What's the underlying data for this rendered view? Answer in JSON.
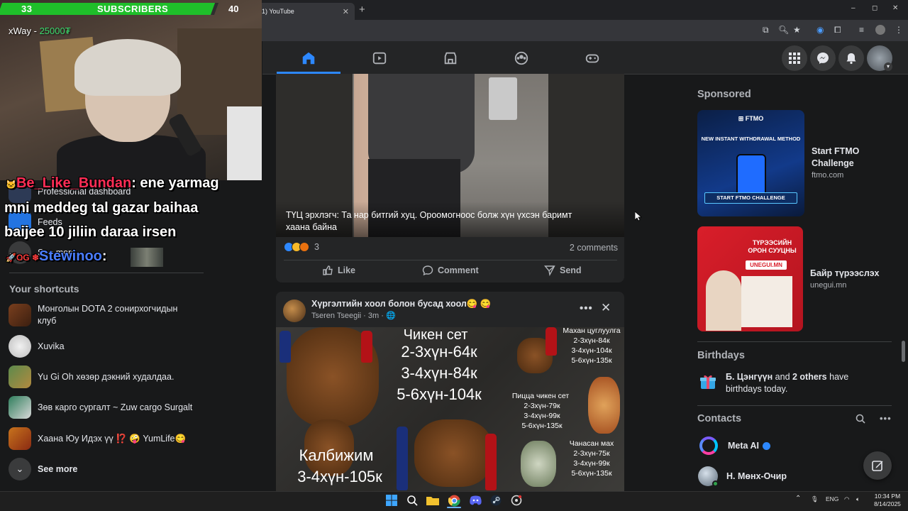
{
  "overlay": {
    "sub_left": "33",
    "sub_label": "SUBSCRIBERS",
    "sub_goal": "40",
    "streamer_name": "xWay - ",
    "streamer_count": "25000₮"
  },
  "browser": {
    "tab_title": "(1) YouTube",
    "new_tab": "+",
    "window_controls": [
      "–",
      "◻",
      "✕"
    ]
  },
  "sidebar": {
    "items": [
      {
        "label": "Professional dashboard"
      },
      {
        "label": "Feeds"
      },
      {
        "label": "See more"
      }
    ],
    "shortcuts_heading": "Your shortcuts",
    "shortcuts": [
      {
        "label": "Монголын DOTA 2 сонирхогчидын клуб"
      },
      {
        "label": "Xuvika"
      },
      {
        "label": "Yu Gi Oh хөзөр дэкний худалдаа."
      },
      {
        "label": "Зөв карго сургалт ~ Zuw cargo Surgalt"
      },
      {
        "label": "Хаана Юу Идэх үү ⁉️ 🤪 YumLife😋"
      }
    ],
    "see_more_bottom": "See more"
  },
  "chat": {
    "user1": "Be_Like_Bundan",
    "msg1_a": ":  ene yarmag",
    "msg1_b": "mni meddeg tal gazar baihaa",
    "msg1_c": "baijee 10 jiliin daraa irsen",
    "user2": "Stewinoo",
    "msg2": ":"
  },
  "post1": {
    "caption": "ТҮЦ эрхлэгч: Та нар битгий хуц. Ороомогноос болж хүн үхсэн баримт хаана байна",
    "reaction_count": "3",
    "comments": "2 comments",
    "actions": {
      "like": "Like",
      "comment": "Comment",
      "send": "Send"
    }
  },
  "post2": {
    "title": "Хүргэлтийн хоол болон бусад хоол😋 😋",
    "author": "Tseren Tseegii · 3m · 🌐",
    "more": "•••",
    "close": "✕",
    "menu": {
      "main_title": "Чикен сет",
      "main_lines": [
        "2-3хүн-64к",
        "3-4хүн-84к",
        "5-6хүн-104к"
      ],
      "meat_title": "Махан цуглуулга",
      "meat_lines": [
        "2-3хүн-84к",
        "3-4хүн-104к",
        "5-6хүн-135к"
      ],
      "pizza_title": "Пицца чикен сет",
      "pizza_lines": [
        "2-3хүн-79к",
        "3-4хүн-99к",
        "5-6хүн-135к"
      ],
      "kalb_title": "Калбижим",
      "kalb_line": "3-4хүн-105к",
      "chan_title": "Чанасан мах",
      "chan_lines": [
        "2-3хүн-75к",
        "3-4хүн-99к",
        "5-6хүн-135к"
      ]
    }
  },
  "right": {
    "sponsored": "Sponsored",
    "ads": [
      {
        "title": "Start FTMO Challenge",
        "url": "ftmo.com",
        "logo": "⊞ FTMO",
        "headline": "NEW INSTANT WITHDRAWAL METHOD",
        "cta": "START FTMO CHALLENGE"
      },
      {
        "title": "Байр түрээслэх",
        "url": "unegui.mn",
        "headline": "ТҮРЭЭСИЙН ОРОН СУУЦНЫ",
        "badge": "UNEGUI.MN"
      }
    ],
    "birthdays_heading": "Birthdays",
    "birthday_name": "Б. Цэнгүүн",
    "birthday_mid": " and ",
    "birthday_others": "2 others",
    "birthday_tail": " have birthdays today.",
    "contacts_heading": "Contacts",
    "contacts": [
      {
        "name": "Meta AI"
      },
      {
        "name": "Н. Мөнх-Очир"
      }
    ]
  },
  "taskbar": {
    "lang": "ENG",
    "time": "10:34 PM",
    "date": "8/14/2025"
  },
  "colors": {
    "fb_blue": "#2d88ff",
    "sub_green": "#1fbf2a",
    "chat_user1": "#ff2d55",
    "chat_user2": "#4a7dff"
  }
}
